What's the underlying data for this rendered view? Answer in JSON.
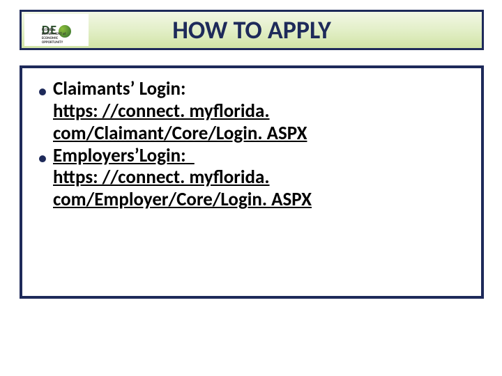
{
  "header": {
    "logo_text": "DE",
    "logo_subtext": "FLORIDA DEPARTMENT of ECONOMIC OPPORTUNITY",
    "title": "HOW TO APPLY"
  },
  "body": {
    "bullets": [
      {
        "label": "Claimants’ Login:",
        "url_display": "https: //connect. myflorida. com/Claimant/Core/Login. ASPX"
      },
      {
        "label": "Employers’Login:",
        "url_display": "https: //connect. myflorida. com/Employer/Core/Login. ASPX"
      }
    ]
  }
}
